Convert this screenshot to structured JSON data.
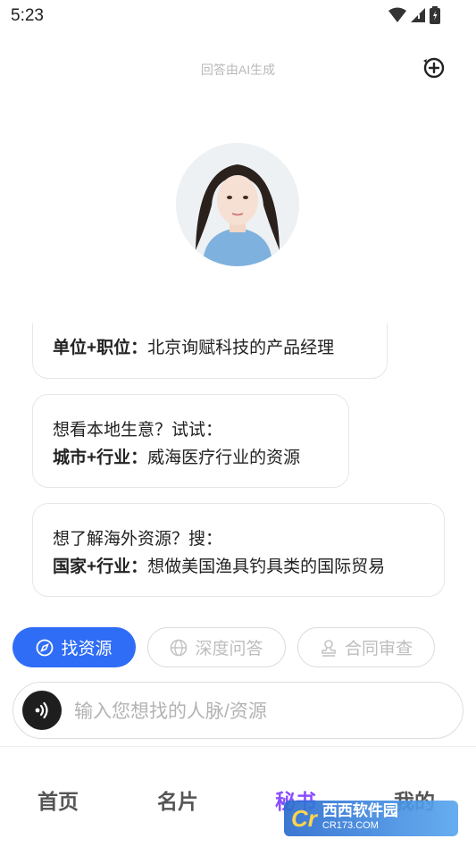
{
  "status_bar": {
    "time": "5:23"
  },
  "header": {
    "ai_note": "回答由AI生成",
    "new_chat_icon": "chat-plus-icon"
  },
  "cards": [
    {
      "line1": "",
      "line2_bold": "单位+职位：",
      "line2_text": "北京询赋科技的产品经理"
    },
    {
      "line1": "想看本地生意？试试：",
      "line2_bold": "城市+行业：",
      "line2_text": "威海医疗行业的资源"
    },
    {
      "line1": "想了解海外资源？搜：",
      "line2_bold": "国家+行业：",
      "line2_text": "想做美国渔具钓具类的国际贸易"
    }
  ],
  "chips": [
    {
      "label": "找资源",
      "icon": "compass-icon",
      "active": true
    },
    {
      "label": "深度问答",
      "icon": "globe-icon",
      "active": false
    },
    {
      "label": "合同审查",
      "icon": "stamp-icon",
      "active": false
    }
  ],
  "input": {
    "placeholder": "输入您想找的人脉/资源",
    "voice_icon": "voice-icon"
  },
  "tabs": [
    {
      "label": "首页"
    },
    {
      "label": "名片"
    },
    {
      "label": "秘书",
      "active": true
    },
    {
      "label": "我的"
    }
  ],
  "watermark": {
    "title": "西西软件园",
    "sub": "CR173.COM"
  },
  "colors": {
    "accent": "#2f6df6",
    "active_tab": "#8a4dff",
    "placeholder": "#b3b3b3"
  }
}
